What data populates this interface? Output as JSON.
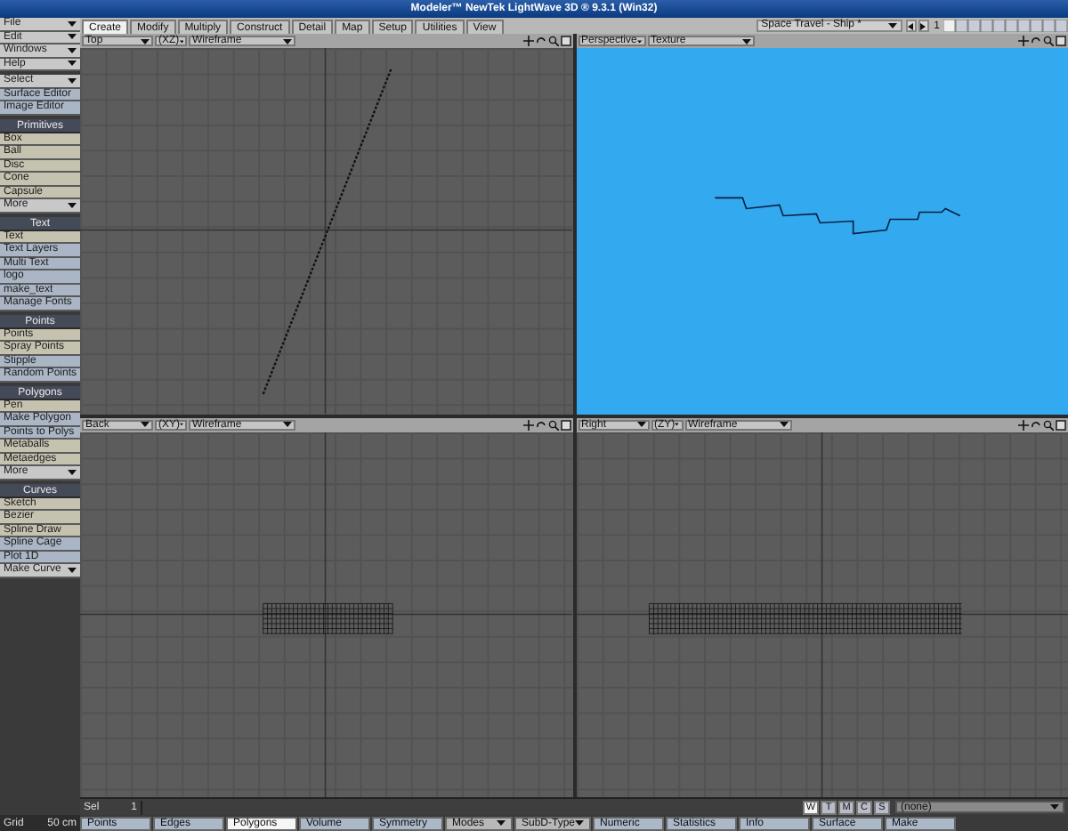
{
  "window": {
    "title": "Modeler™ NewTek LightWave 3D ® 9.3.1 (Win32)"
  },
  "tabs": [
    {
      "label": "Create",
      "selected": true
    },
    {
      "label": "Modify",
      "selected": false
    },
    {
      "label": "Multiply",
      "selected": false
    },
    {
      "label": "Construct",
      "selected": false
    },
    {
      "label": "Detail",
      "selected": false
    },
    {
      "label": "Map",
      "selected": false
    },
    {
      "label": "Setup",
      "selected": false
    },
    {
      "label": "Utilities",
      "selected": false
    },
    {
      "label": "View",
      "selected": false
    }
  ],
  "scene": {
    "name": "Space Travel - Ship *",
    "layer": "1"
  },
  "sidebar": [
    {
      "items": [
        {
          "label": "File",
          "kind": "menu"
        },
        {
          "label": "Edit",
          "kind": "menu"
        },
        {
          "label": "Windows",
          "kind": "menu"
        },
        {
          "label": "Help",
          "kind": "menu"
        }
      ]
    },
    {
      "items": [
        {
          "label": "Select",
          "kind": "menu"
        },
        {
          "label": "Surface Editor",
          "kind": "plugin"
        },
        {
          "label": "Image Editor",
          "kind": "plugin"
        }
      ]
    },
    {
      "title": "Primitives",
      "items": [
        {
          "label": "Box",
          "kind": "tool"
        },
        {
          "label": "Ball",
          "kind": "tool"
        },
        {
          "label": "Disc",
          "kind": "tool"
        },
        {
          "label": "Cone",
          "kind": "tool"
        },
        {
          "label": "Capsule",
          "kind": "tool"
        },
        {
          "label": "More",
          "kind": "menu"
        }
      ]
    },
    {
      "title": "Text",
      "items": [
        {
          "label": "Text",
          "kind": "tool"
        },
        {
          "label": "Text Layers",
          "kind": "plugin"
        },
        {
          "label": "Multi Text",
          "kind": "plugin"
        },
        {
          "label": "logo",
          "kind": "plugin"
        },
        {
          "label": "make_text",
          "kind": "plugin"
        },
        {
          "label": "Manage Fonts",
          "kind": "plugin"
        }
      ]
    },
    {
      "title": "Points",
      "items": [
        {
          "label": "Points",
          "kind": "tool"
        },
        {
          "label": "Spray Points",
          "kind": "tool"
        },
        {
          "label": "Stipple",
          "kind": "plugin"
        },
        {
          "label": "Random Points",
          "kind": "plugin"
        }
      ]
    },
    {
      "title": "Polygons",
      "items": [
        {
          "label": "Pen",
          "kind": "tool"
        },
        {
          "label": "Make Polygon",
          "kind": "plugin"
        },
        {
          "label": "Points to Polys",
          "kind": "plugin"
        },
        {
          "label": "Metaballs",
          "kind": "tool"
        },
        {
          "label": "Metaedges",
          "kind": "tool"
        },
        {
          "label": "More",
          "kind": "menu"
        }
      ]
    },
    {
      "title": "Curves",
      "items": [
        {
          "label": "Sketch",
          "kind": "tool"
        },
        {
          "label": "Bezier",
          "kind": "tool"
        },
        {
          "label": "Spline Draw",
          "kind": "tool"
        },
        {
          "label": "Spline Cage",
          "kind": "plugin"
        },
        {
          "label": "Plot 1D",
          "kind": "plugin"
        },
        {
          "label": "Make Curve",
          "kind": "menu"
        }
      ]
    }
  ],
  "viewports": [
    {
      "view": "Top",
      "axes": "(XZ)",
      "mode": "Wireframe",
      "kind": "line"
    },
    {
      "view": "Perspective",
      "mode": "Texture",
      "kind": "perspective"
    },
    {
      "view": "Back",
      "axes": "(XY)",
      "mode": "Wireframe",
      "kind": "mesh-front"
    },
    {
      "view": "Right",
      "axes": "(ZY)",
      "mode": "Wireframe",
      "kind": "mesh-side"
    }
  ],
  "status": {
    "grid_label": "Grid",
    "grid_value": "50 cm",
    "sel_label": "Sel",
    "sel_value": "1"
  },
  "mode_buttons": [
    {
      "label": "Points",
      "kind": "toggle",
      "selected": false
    },
    {
      "label": "Edges",
      "kind": "toggle",
      "selected": false
    },
    {
      "label": "Polygons",
      "kind": "toggle",
      "selected": true
    },
    {
      "label": "Volume",
      "kind": "toggle",
      "selected": false
    },
    {
      "label": "Symmetry",
      "kind": "toggle",
      "selected": false
    },
    {
      "label": "Modes",
      "kind": "menu",
      "selected": false
    },
    {
      "label": "SubD-Type",
      "kind": "menu",
      "selected": false
    },
    {
      "label": "Numeric",
      "kind": "toggle",
      "selected": false
    },
    {
      "label": "Statistics",
      "kind": "toggle",
      "selected": false
    },
    {
      "label": "Info",
      "kind": "toggle",
      "selected": false
    },
    {
      "label": "Surface",
      "kind": "toggle",
      "selected": false
    },
    {
      "label": "Make",
      "kind": "toggle",
      "selected": false
    }
  ],
  "edit_modes": [
    {
      "label": "W",
      "selected": true
    },
    {
      "label": "T",
      "selected": false
    },
    {
      "label": "M",
      "selected": false
    },
    {
      "label": "C",
      "selected": false
    },
    {
      "label": "S",
      "selected": false
    }
  ],
  "surface_select": "(none)"
}
